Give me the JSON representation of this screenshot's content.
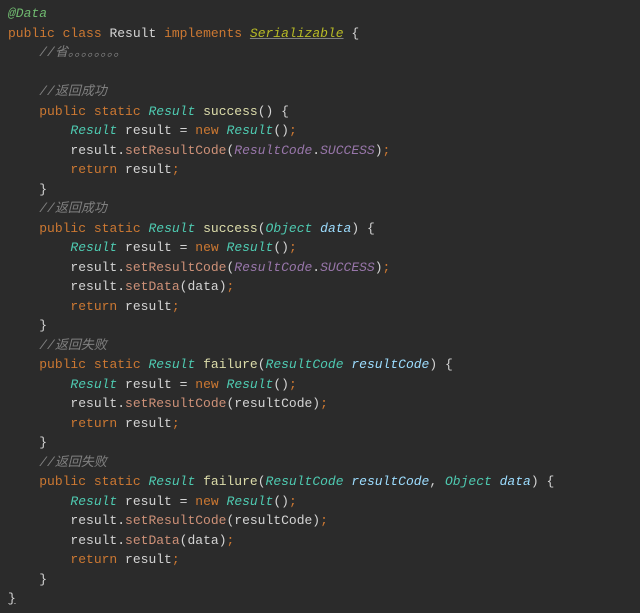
{
  "code": {
    "annotation": "@Data",
    "publicKw": "public",
    "classKw": "class",
    "className": "Result",
    "implementsKw": "implements",
    "interface": "Serializable",
    "openBrace": "{",
    "closeBrace": "}",
    "commentOmit": "//省。。。。。。。。",
    "commentSuccess": "//返回成功",
    "commentFailure": "//返回失败",
    "staticKw": "static",
    "returnType": "Result",
    "methodSuccess": "success",
    "methodFailure": "failure",
    "paramObject": "Object",
    "paramData": "data",
    "paramResultCode": "ResultCode",
    "paramResultCodeName": "resultCode",
    "varResult": "result",
    "newKw": "new",
    "constructor": "Result",
    "setResultCode": "setResultCode",
    "setData": "setData",
    "enumClass": "ResultCode",
    "enumSuccess": "SUCCESS",
    "returnKw": "return",
    "equals": "=",
    "dot": ".",
    "semi": ";",
    "comma": ",",
    "lparen": "(",
    "rparen": ")",
    "lbrace": "{",
    "rbrace": "}"
  }
}
